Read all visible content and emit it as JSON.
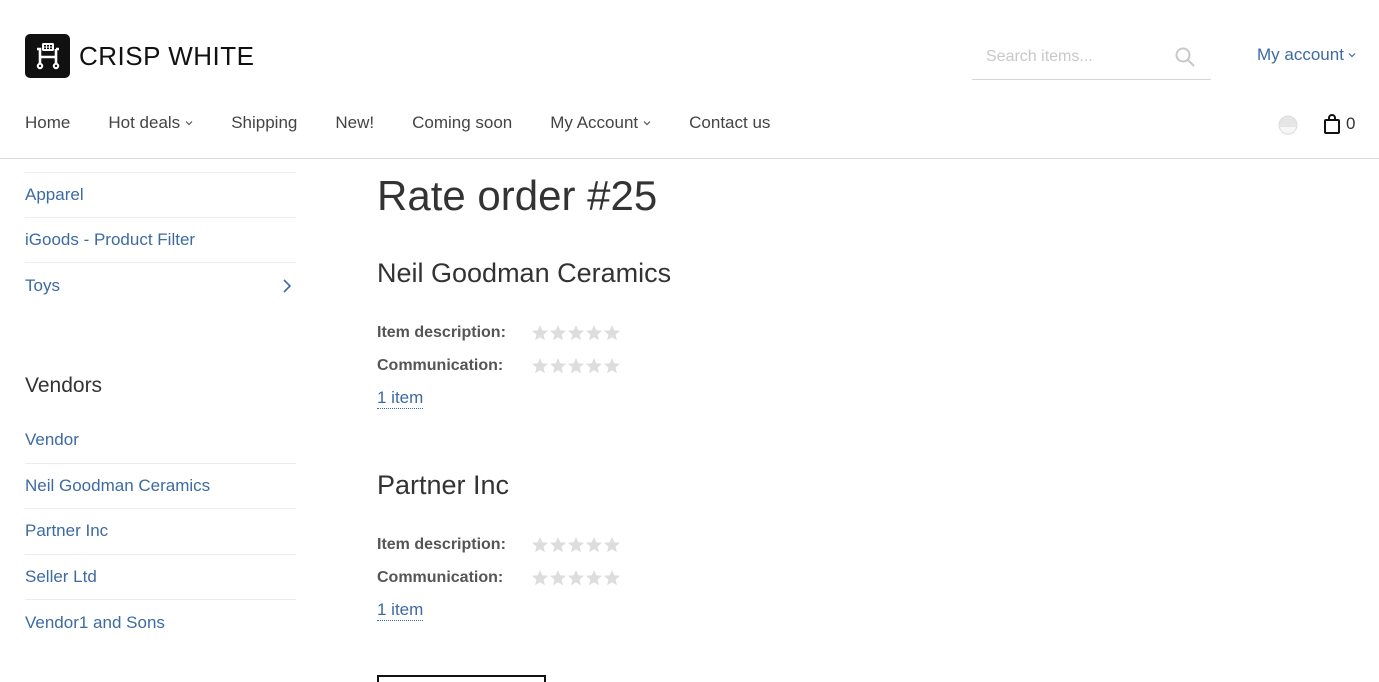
{
  "header": {
    "logo_text": "CRISP WHITE",
    "search_placeholder": "Search items...",
    "account_label": "My account",
    "cart_count": "0"
  },
  "nav": {
    "items": [
      {
        "label": "Home",
        "dropdown": false
      },
      {
        "label": "Hot deals",
        "dropdown": true
      },
      {
        "label": "Shipping",
        "dropdown": false
      },
      {
        "label": "New!",
        "dropdown": false
      },
      {
        "label": "Coming soon",
        "dropdown": false
      },
      {
        "label": "My Account",
        "dropdown": true
      },
      {
        "label": "Contact us",
        "dropdown": false
      }
    ]
  },
  "sidebar": {
    "categories": [
      {
        "label": "Apparel"
      },
      {
        "label": "iGoods - Product Filter"
      },
      {
        "label": "Toys"
      }
    ],
    "vendors_title": "Vendors",
    "vendors": [
      {
        "label": "Vendor"
      },
      {
        "label": "Neil Goodman Ceramics"
      },
      {
        "label": "Partner Inc"
      },
      {
        "label": "Seller Ltd"
      },
      {
        "label": "Vendor1 and Sons"
      }
    ]
  },
  "main": {
    "title": "Rate order #25",
    "vendor_ratings": [
      {
        "name": "Neil Goodman Ceramics",
        "item_description_label": "Item description:",
        "item_description_stars": 0,
        "communication_label": "Communication:",
        "communication_stars": 0,
        "items_link": "1 item"
      },
      {
        "name": "Partner Inc",
        "item_description_label": "Item description:",
        "item_description_stars": 0,
        "communication_label": "Communication:",
        "communication_stars": 0,
        "items_link": "1 item"
      }
    ]
  },
  "colors": {
    "link": "#3d6aa2",
    "star_empty": "#dddddd",
    "text": "#333333"
  }
}
